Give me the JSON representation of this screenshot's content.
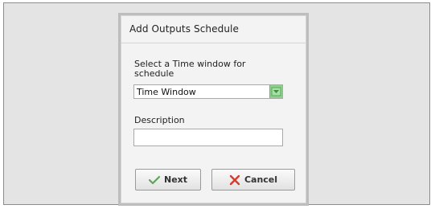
{
  "dialog": {
    "title": "Add Outputs Schedule",
    "time_window_label": "Select a Time window for schedule",
    "time_window_value": "Time Window",
    "description_label": "Description",
    "description_value": ""
  },
  "buttons": {
    "next_label": "Next",
    "cancel_label": "Cancel"
  },
  "colors": {
    "next_icon": "#5fa35f",
    "cancel_icon": "#d83a2e",
    "dropdown_accent": "#8fd08f"
  },
  "icons": {
    "next": "checkmark-icon",
    "cancel": "x-icon",
    "dropdown": "dropdown-arrow-icon"
  }
}
